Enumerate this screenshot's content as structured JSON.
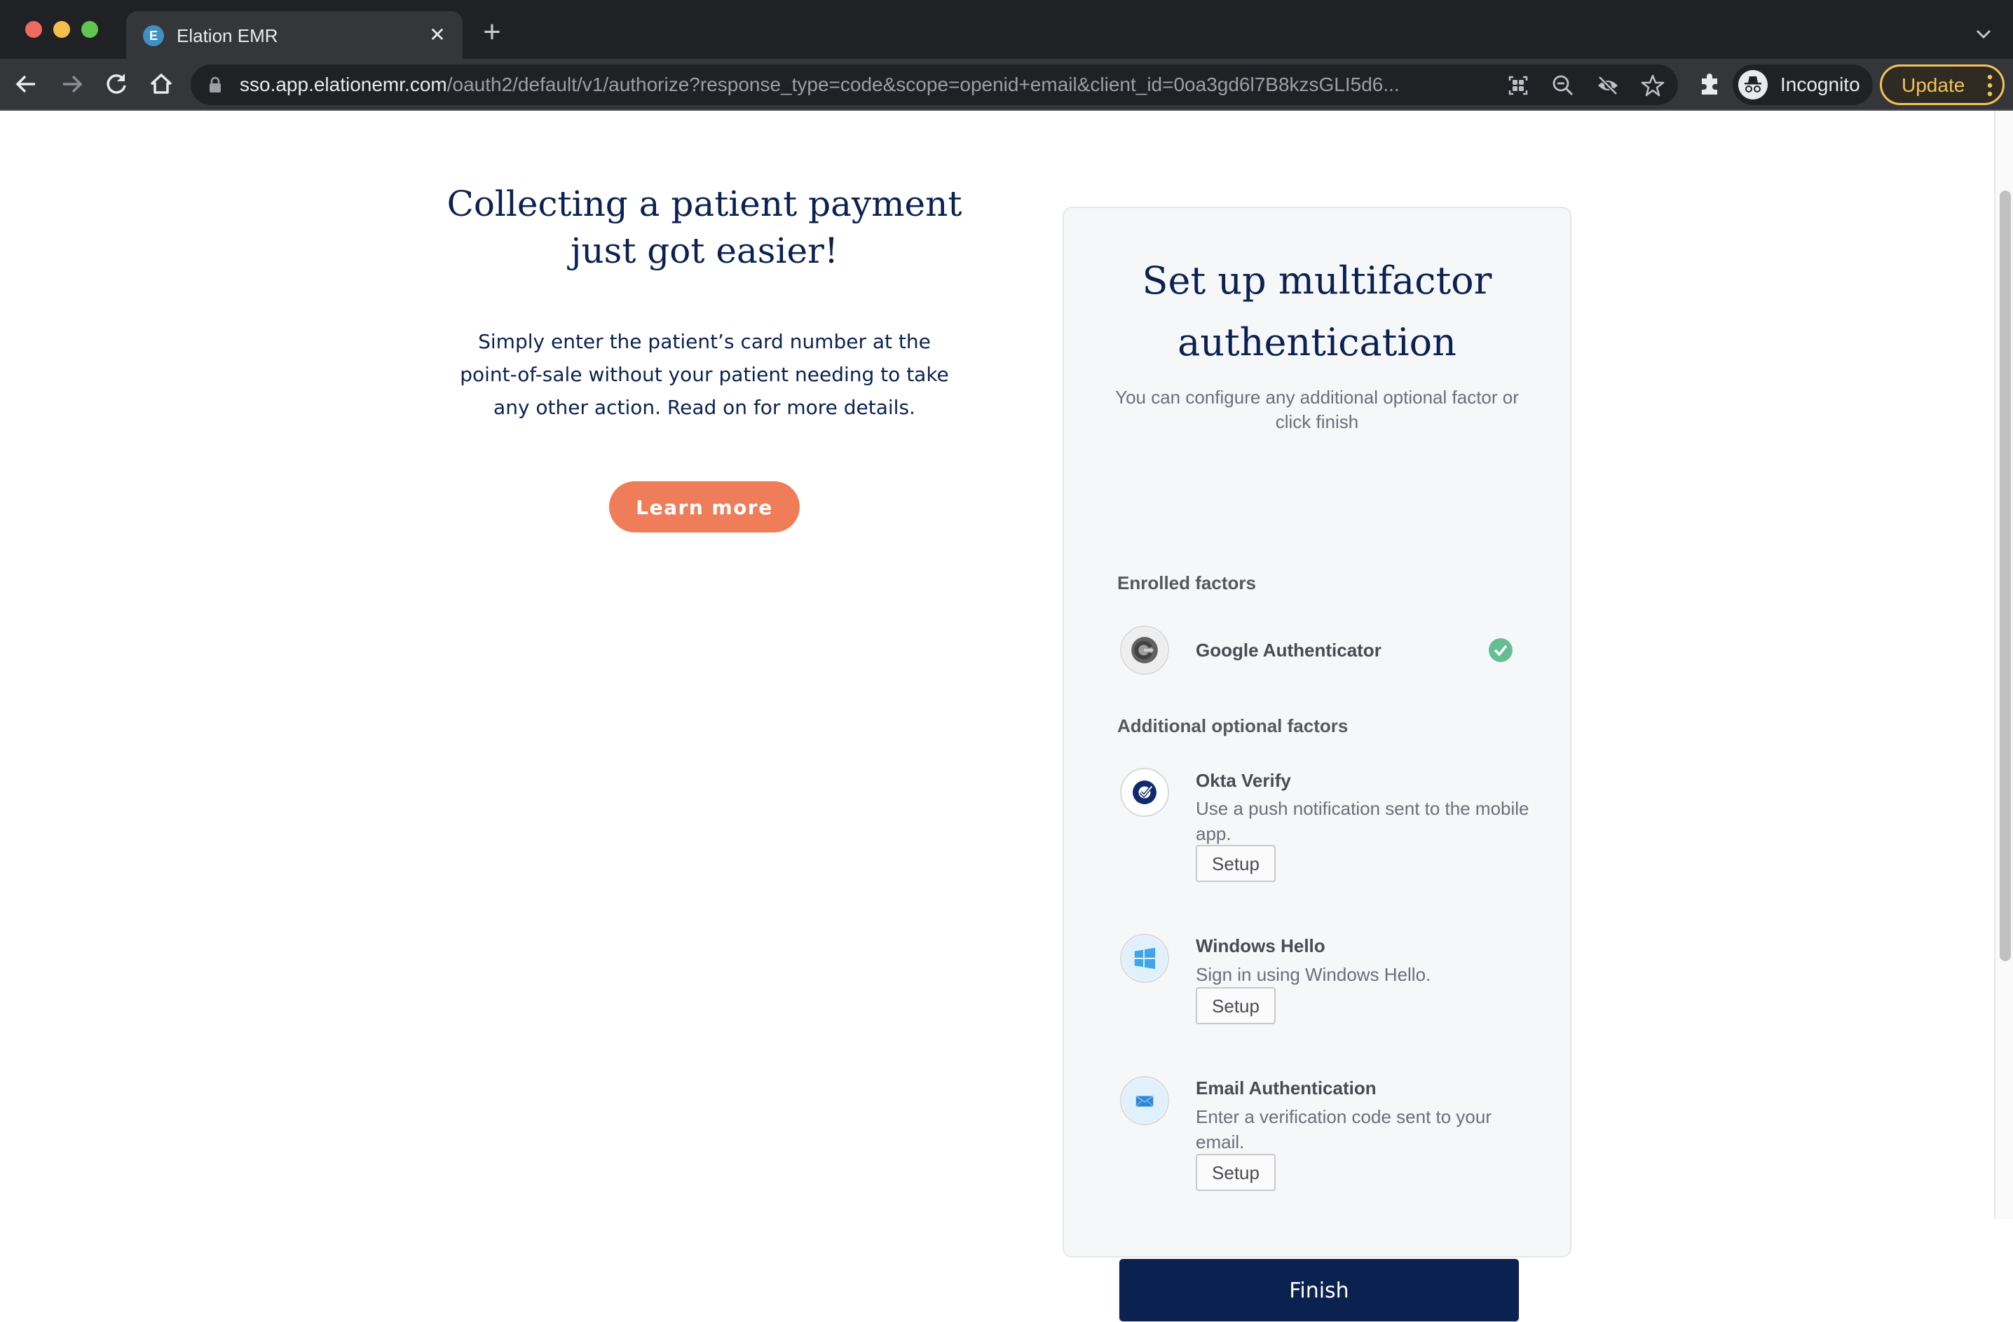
{
  "browser": {
    "tab": {
      "title": "Elation EMR",
      "favicon_letter": "E"
    },
    "new_tab_label": "+",
    "close_tab_label": "✕",
    "address_bar": {
      "host": "sso.app.elationemr.com",
      "path": "/oauth2/default/v1/authorize?response_type=code&scope=openid+email&client_id=0oa3gd6l7B8kzsGLI5d6..."
    },
    "profile_label": "Incognito",
    "update_label": "Update"
  },
  "promo": {
    "title": "Collecting a patient payment just got easier!",
    "body": "Simply enter the patient’s card number at the point-of-sale without your patient needing to take any other action. Read on for more details.",
    "button_label": "Learn more",
    "accent_color": "#ef7d59"
  },
  "mfa": {
    "title": "Set up multifactor authentication",
    "subtitle": "You can configure any additional optional factor or click finish",
    "enrolled_label": "Enrolled factors",
    "enrolled": [
      {
        "name": "Google Authenticator",
        "icon": "google-authenticator-icon",
        "status": "enrolled"
      }
    ],
    "optional_label": "Additional optional factors",
    "optional": [
      {
        "name": "Okta Verify",
        "description": "Use a push notification sent to the mobile app.",
        "icon": "okta-verify-icon",
        "button": "Setup"
      },
      {
        "name": "Windows Hello",
        "description": "Sign in using Windows Hello.",
        "icon": "windows-icon",
        "button": "Setup"
      },
      {
        "name": "Email Authentication",
        "description": "Enter a verification code sent to your email.",
        "icon": "email-icon",
        "button": "Setup"
      }
    ],
    "finish_label": "Finish",
    "primary_color": "#0b2250",
    "success_color": "#65bd96"
  }
}
